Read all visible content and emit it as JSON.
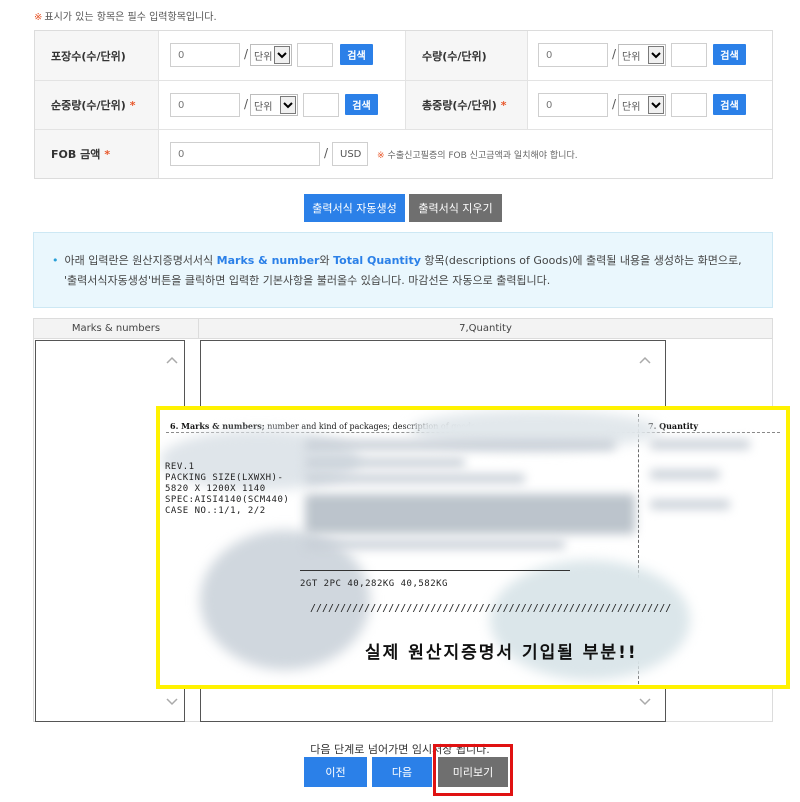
{
  "required_note": {
    "mark": "※",
    "text": "표시가 있는 항목은 필수 입력항목입니다."
  },
  "form": {
    "packages": {
      "label": "포장수(수/단위)",
      "value": "0",
      "slash": "/",
      "unit": "단위",
      "search": "검색"
    },
    "quantity": {
      "label": "수량(수/단위)",
      "value": "0",
      "slash": "/",
      "unit": "단위",
      "search": "검색"
    },
    "net_weight": {
      "label": "순중량(수/단위)",
      "star": "*",
      "value": "0",
      "slash": "/",
      "unit": "단위",
      "search": "검색"
    },
    "gross_weight": {
      "label": "총중량(수/단위)",
      "star": "*",
      "value": "0",
      "slash": "/",
      "unit": "단위",
      "search": "검색"
    },
    "fob": {
      "label": "FOB 금액",
      "star": "*",
      "value": "0",
      "slash": "/",
      "currency": "USD",
      "note_mark": "※",
      "note": "수출신고필증의 FOB 신고금액과 일치해야 합니다."
    }
  },
  "actions": {
    "auto_generate": "출력서식 자동생성",
    "clear": "출력서식 지우기"
  },
  "info": {
    "bullet": "•",
    "t1": "아래 입력란은 원산지증명서서식 ",
    "marks": "Marks & number",
    "t2": "와 ",
    "total_qty": "Total Quantity",
    "t3": " 항목(descriptions of Goods)에 출력될 내용을 생성하는 화면으로,",
    "line2": "'출력서식자동생성'버튼을 클릭하면 입력한 기본사항을 불러올수 있습니다. 마감선은 자동으로 출력됩니다."
  },
  "grid": {
    "col1": "Marks & numbers",
    "col2": "7,Quantity"
  },
  "preview": {
    "head_left_bold": "6. Marks & numbers;",
    "head_left_rest": " number and kind of packages; description of goods",
    "head_right": "7. Quantity",
    "lines": [
      "REV.1",
      "PACKING SIZE(LXWXH)-",
      "5820 X 1200X 1140",
      "SPEC:AISI4140(SCM440)",
      "CASE NO.:1/1, 2/2"
    ],
    "weights": "2GT 2PC 40,282KG 40,582KG",
    "slashes": "////////////////////////////////////////////////////////////",
    "caption": "실제 원산지증명서 기입될 부분!!"
  },
  "footer": {
    "note": "다음 단계로 넘어가면 임시저장 됩니다.",
    "prev": "이전",
    "next": "다음",
    "preview": "미리보기"
  },
  "colors": {
    "accent": "#2b80e8",
    "gray_button": "#6f6f6f",
    "highlight": "#fff200",
    "annotation": "#e01212"
  }
}
